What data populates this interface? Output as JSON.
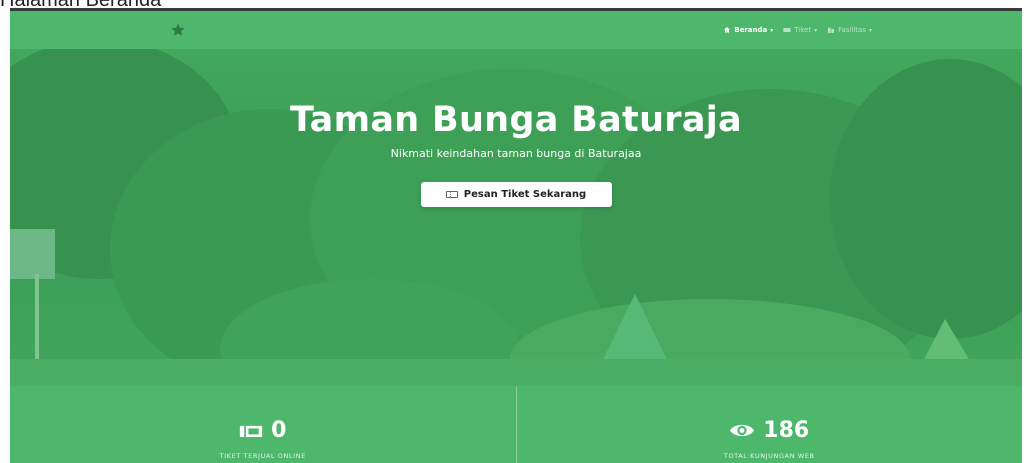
{
  "caption": "Halaman Beranda",
  "navbar": {
    "brand_icon": "star-icon",
    "items": [
      {
        "label": "Beranda",
        "icon": "home-icon",
        "active": true
      },
      {
        "label": "Tiket",
        "icon": "ticket-icon",
        "active": false
      },
      {
        "label": "Fasilitas",
        "icon": "building-icon",
        "active": false
      }
    ]
  },
  "hero": {
    "title": "Taman Bunga Baturaja",
    "subtitle": "Nikmati keindahan taman bunga di Baturajaa",
    "cta_label": "Pesan Tiket Sekarang",
    "cta_icon": "ticket-icon"
  },
  "stats": [
    {
      "value": "0",
      "label": "TIKET TERJUAL ONLINE",
      "icon": "tickets-icon"
    },
    {
      "value": "186",
      "label": "TOTAL KUNJUNGAN WEB",
      "icon": "eye-icon"
    }
  ],
  "colors": {
    "primary": "#4db86b",
    "overlay": "#3c9d55",
    "white": "#ffffff"
  }
}
